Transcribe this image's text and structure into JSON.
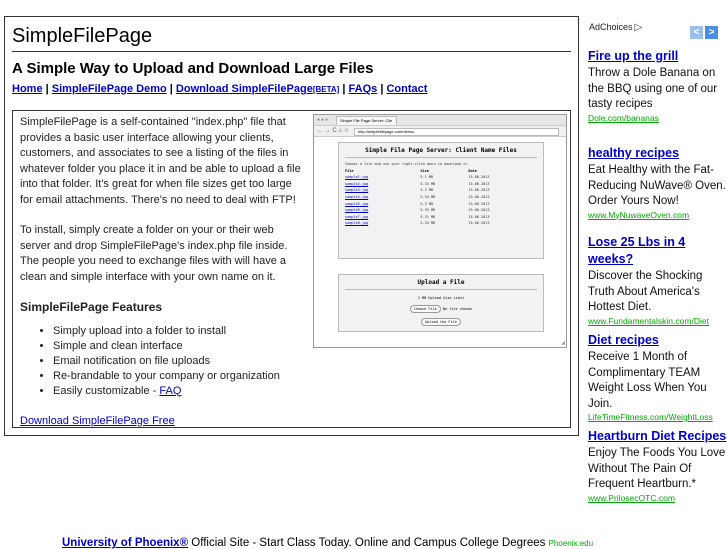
{
  "page": {
    "title": "SimpleFilePage",
    "subtitle": "A Simple Way to Upload and Download Large Files",
    "nav": [
      {
        "label": "Home"
      },
      {
        "label": "SimpleFilePage Demo"
      },
      {
        "label": "Download SimpleFilePage",
        "sup": "[BETA]"
      },
      {
        "label": "FAQs"
      },
      {
        "label": "Contact"
      }
    ],
    "intro1": "SimpleFilePage is a self-contained \"index.php\" file that provides a basic user interface allowing your clients, customers, and associates to see a listing of the files in whatever folder you place it in and be able to upload a file into that folder. It's great for when file sizes get too large for email attachments. There's no need to deal with FTP!",
    "intro2": "To install, simply create a folder on your or their web server and drop SimpleFilePage's index.php file inside. The people you need to exchange files with will have a clean and simple interface with your own name on it.",
    "features_heading": "SimpleFilePage Features",
    "features": [
      "Simply upload into a folder to install",
      "Simple and clean interface",
      "Email notification on file uploads",
      "Re-brandable to your company or organization"
    ],
    "feature_last_text": "Easily customizable - ",
    "feature_last_link": "FAQ",
    "download_link": "Download SimpleFilePage Free"
  },
  "screenshot": {
    "tab_title": "Simple File Page Server: Clie",
    "url": "http://simplefilepage.com/demo/",
    "panel_title": "Simple File Page Server: Client Name Files",
    "panel_note": "Choose a file and use your right-click menu to download it.",
    "columns": [
      "File",
      "Size",
      "Date"
    ],
    "files": [
      {
        "name": "sample1.jpg",
        "size": "5.1 MB",
        "date": "15-06-2013"
      },
      {
        "name": "sample2.jpg",
        "size": "5.33 MB",
        "date": "15-06-2013"
      },
      {
        "name": "sample3.jpg",
        "size": "5.3 MB",
        "date": "15-06-2013"
      },
      {
        "name": "sample4.jpg",
        "size": "5.34 MB",
        "date": "15-06-2013"
      },
      {
        "name": "sample5.jpg",
        "size": "5.3 MB",
        "date": "15-06-2013"
      },
      {
        "name": "sample6.jpg",
        "size": "5.33 MB",
        "date": "15-06-2013"
      },
      {
        "name": "sample7.jpg",
        "size": "5.31 MB",
        "date": "15-06-2013"
      },
      {
        "name": "sample8.jpg",
        "size": "5.34 MB",
        "date": "15-06-2013"
      }
    ],
    "upload_title": "Upload a File",
    "upload_limit": "1 MB Upload Size Limit",
    "choose_button": "Choose File",
    "no_file": "No file chosen",
    "upload_button": "Upload the File"
  },
  "ads": {
    "adchoices": "AdChoices",
    "items": [
      {
        "headline": "Fire up the grill",
        "desc": "Throw a Dole Banana on the BBQ using one of our tasty recipes",
        "url": "Dole.com/bananas"
      },
      {
        "headline": "healthy recipes",
        "desc": "Eat Healthy with the Fat-Reducing NuWave® Oven. Order Yours Now!",
        "url": "www.MyNuwaveOven.com"
      },
      {
        "headline": "Lose 25 Lbs in 4 weeks?",
        "desc": "Discover the Shocking Truth About America's Hottest Diet.",
        "url": "www.Fundamentalskin.com/Diet"
      },
      {
        "headline": "Diet recipes",
        "desc": "Receive 1 Month of Complimentary TEAM Weight Loss When You Join.",
        "url": "LifeTimeFitness.com/WeightLoss"
      },
      {
        "headline": "Heartburn Diet Recipes",
        "desc": "Enjoy The Foods You Love Without The Pain Of Frequent Heartburn.*",
        "url": "www.PrilosecOTC.com"
      }
    ],
    "bottom": {
      "headline": "University of Phoenix®",
      "desc": "Official Site - Start Class Today. Online and Campus College Degrees",
      "url": "Phoenix.edu"
    }
  }
}
